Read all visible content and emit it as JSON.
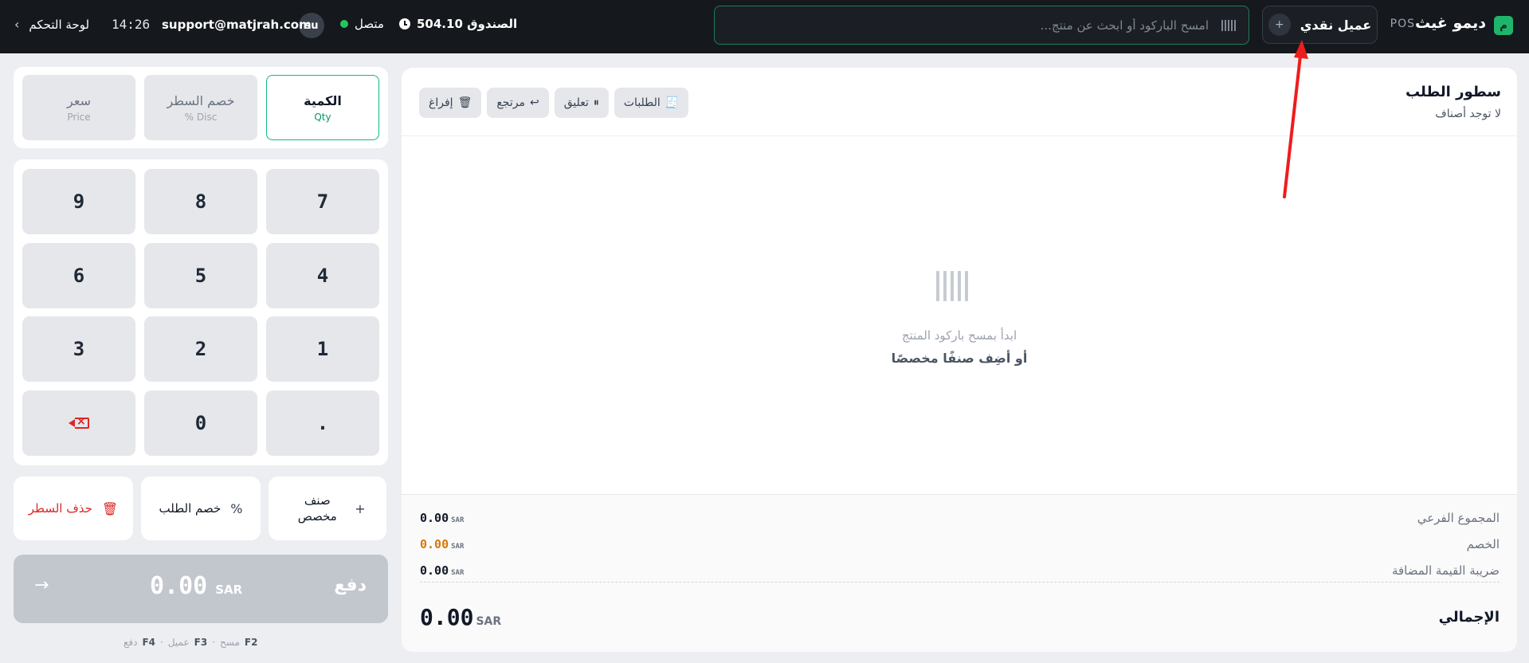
{
  "header": {
    "brand_initial": "م",
    "brand_name": "ديمو غيث",
    "pos_tag": "POS",
    "customer_button_label": "عميل نقدي",
    "customer_add_symbol": "+",
    "search_placeholder": "امسح الباركود أو ابحث عن منتج...",
    "till_label": "الصندوق 504.10",
    "status_label": "متصل",
    "avatar_initials": "su",
    "user_email": "support@matjrah.com",
    "time": "14:26",
    "dashboard_link": "لوحة التحكم"
  },
  "order": {
    "title": "سطور الطلب",
    "subtitle": "لا توجد أصناف",
    "actions": {
      "orders": "الطلبات",
      "suspend": "تعليق",
      "return": "مرتجع",
      "clear": "إفراغ"
    },
    "empty_hint": "ابدأ بمسح باركود المنتج",
    "empty_cta": "أو أضِف صنفًا مخصصًا"
  },
  "totals": {
    "currency": "SAR",
    "subtotal_label": "المجموع الفرعي",
    "subtotal_value": "0.00",
    "discount_label": "الخصم",
    "discount_value": "0.00",
    "vat_label": "ضريبة القيمة المضافة",
    "vat_value": "0.00",
    "grand_label": "الإجمالي",
    "grand_value": "0.00"
  },
  "modes": [
    {
      "main": "الكمية",
      "sub": "Qty",
      "active": true
    },
    {
      "main": "خصم السطر",
      "sub": "% Disc",
      "active": false
    },
    {
      "main": "سعر",
      "sub": "Price",
      "active": false
    }
  ],
  "keys": [
    "7",
    "8",
    "9",
    "4",
    "5",
    "6",
    "1",
    "2",
    "3",
    ".",
    "0"
  ],
  "line_actions": {
    "custom_item": "صنف مخصص",
    "order_discount": "خصم الطلب",
    "delete_line": "حذف السطر"
  },
  "pay": {
    "label": "دفع",
    "amount": "0.00",
    "currency": "SAR"
  },
  "shortcuts": [
    {
      "key": "F2",
      "label": "مسح"
    },
    {
      "key": "F3",
      "label": "عميل"
    },
    {
      "key": "F4",
      "label": "دفع"
    }
  ],
  "colors": {
    "topbar": "#15181d",
    "accent_green": "#10b981",
    "online_dot": "#22c55e",
    "discount_orange": "#d97706",
    "danger_red": "#dc2626",
    "annotation_arrow": "#ef1c1c"
  },
  "icons": {
    "orders": "receipt-icon",
    "suspend": "pause-icon",
    "return": "return-arrow-icon",
    "clear": "trash-icon",
    "search": "barcode-icon",
    "backspace": "backspace-icon",
    "pay": "arrow-right-icon"
  }
}
